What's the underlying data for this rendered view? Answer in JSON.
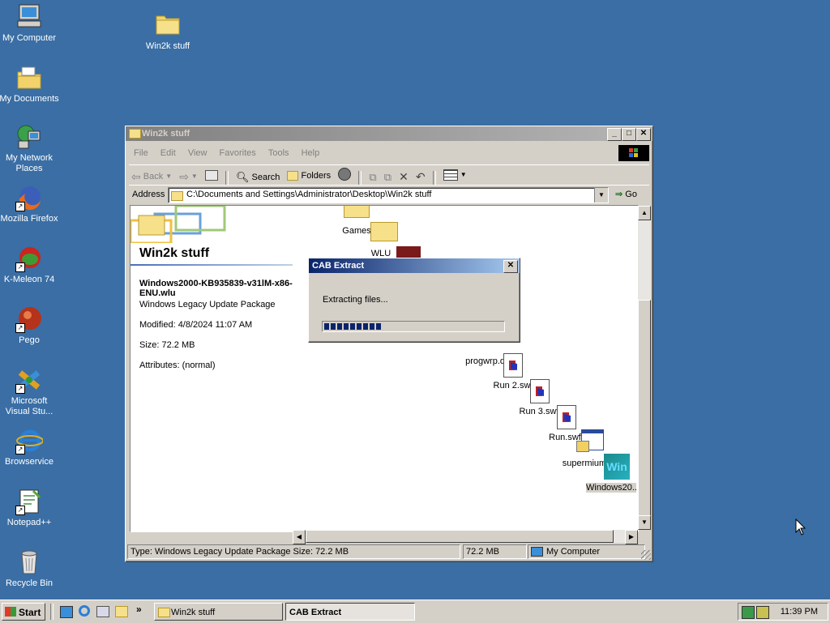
{
  "desktop_icons": [
    {
      "label": "My Computer"
    },
    {
      "label": "My Documents"
    },
    {
      "label": "My Network Places"
    },
    {
      "label": "Mozilla Firefox"
    },
    {
      "label": "K-Meleon 74"
    },
    {
      "label": "Pego"
    },
    {
      "label": "Microsoft Visual Stu..."
    },
    {
      "label": "Browservice"
    },
    {
      "label": "Notepad++"
    },
    {
      "label": "Recycle Bin"
    },
    {
      "label": "Win2k stuff"
    }
  ],
  "explorer": {
    "title": "Win2k stuff",
    "menu": [
      "File",
      "Edit",
      "View",
      "Favorites",
      "Tools",
      "Help"
    ],
    "toolbar": {
      "back": "Back",
      "search": "Search",
      "folders": "Folders"
    },
    "address_label": "Address",
    "address_value": "C:\\Documents and Settings\\Administrator\\Desktop\\Win2k stuff",
    "go_label": "Go",
    "panel": {
      "folder_title": "Win2k stuff",
      "file_name": "Windows2000-KB935839-v31lM-x86-ENU.wlu",
      "file_type": "Windows Legacy Update Package",
      "modified": "Modified: 4/8/2024 11:07 AM",
      "size": "Size: 72.2 MB",
      "attributes": "Attributes: (normal)"
    },
    "files": [
      "Games",
      "WLU",
      "progwrp.dll",
      "Run 2.swf",
      "Run 3.swf",
      "Run.swf",
      "supermium",
      "Windows20..."
    ],
    "status": {
      "type_text": "Type: Windows Legacy Update Package Size: 72.2 MB",
      "size": "72.2 MB",
      "zone": "My Computer"
    }
  },
  "cab_dialog": {
    "title": "CAB Extract",
    "message": "Extracting files...",
    "progress_segments": 9
  },
  "taskbar": {
    "start_label": "Start",
    "tasks": [
      "Win2k stuff",
      "CAB Extract"
    ],
    "clock": "11:39 PM"
  },
  "colors": {
    "desktop": "#3a6ea5",
    "title_active": "#0a246a",
    "progress": "#0a246a"
  }
}
